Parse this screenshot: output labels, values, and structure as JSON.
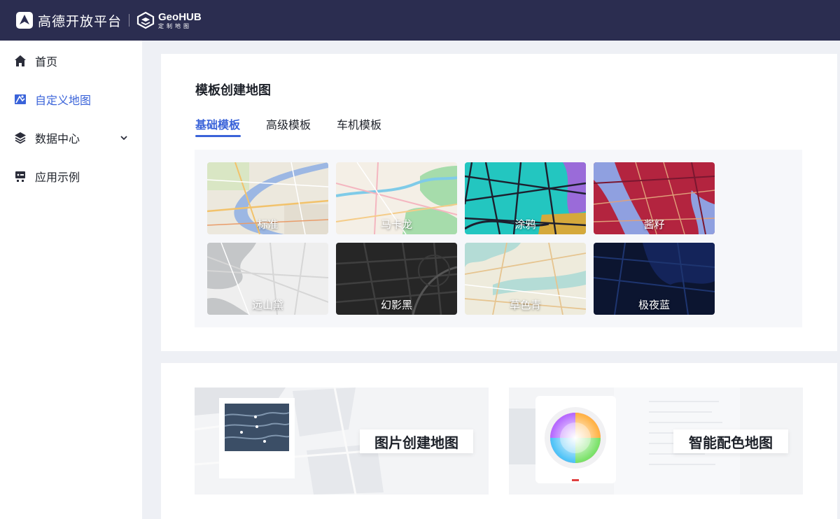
{
  "header": {
    "brand_name": "高德开放平台",
    "geohub_title": "GeoHUB",
    "geohub_subtitle": "定制地图",
    "bg_color": "#2b2d50"
  },
  "sidebar": {
    "items": [
      {
        "label": "首页",
        "icon": "home-icon"
      },
      {
        "label": "自定义地图",
        "icon": "custom-map-icon",
        "active": true
      },
      {
        "label": "数据中心",
        "icon": "layers-icon",
        "expandable": true
      },
      {
        "label": "应用示例",
        "icon": "examples-icon"
      }
    ],
    "accent_color": "#3a63d9"
  },
  "main": {
    "section_title": "模板创建地图",
    "tabs": [
      {
        "label": "基础模板",
        "active": true
      },
      {
        "label": "高级模板"
      },
      {
        "label": "车机模板"
      }
    ],
    "templates": [
      {
        "label": "标准"
      },
      {
        "label": "马卡龙"
      },
      {
        "label": "涂鸦"
      },
      {
        "label": "酱籽"
      },
      {
        "label": "远山黛"
      },
      {
        "label": "幻影黑"
      },
      {
        "label": "草色青"
      },
      {
        "label": "极夜蓝"
      }
    ],
    "create_cards": [
      {
        "label": "图片创建地图"
      },
      {
        "label": "智能配色地图"
      }
    ]
  }
}
